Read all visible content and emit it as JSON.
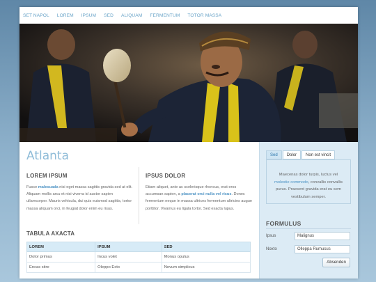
{
  "nav": {
    "items": [
      "SET NAPOL",
      "LOREM",
      "IPSUM",
      "SED",
      "ALIQUAM",
      "FERMENTUM",
      "TOTOR MASSA"
    ]
  },
  "main": {
    "title": "Atlanta",
    "col1": {
      "heading": "LOREM IPSUM",
      "text_before": "Fusce ",
      "link": "malesuada",
      "text_after": " nisi eget massa sagittis gravida sed at elit. Aliquam mollis arcu et nisi viverra id auctor sapien ullamcorper. Mauris vehicula, dui quis euismod sagittis, tortor massa aliquam orci, in feugiat dolor enim eu risus."
    },
    "col2": {
      "heading": "IPSUS DOLOR",
      "text_before": "Etiam aliquet, ante ac scelerisque rhoncus, erat eros accumsan sapien, a ",
      "link": "placerat orci nulla vel risus",
      "text_after": ". Donec fermentum neque in massa ultrices fermentum ultricies augue porttitor. Vivamus eu ligula tortor. Sed exacta lupus."
    },
    "table": {
      "heading": "TABULA AXACTA",
      "columns": [
        "LOREM",
        "IPSUM",
        "SED"
      ],
      "rows": [
        [
          "Dolor primus",
          "Incus volet",
          "Monus opulus"
        ],
        [
          "Encas sitre",
          "Oleppo Exto",
          "Novum simplicus"
        ]
      ]
    }
  },
  "sidebar": {
    "tabs": [
      "Sed",
      "Dolor",
      "Non est vincit"
    ],
    "tab_text_before": "Maecenas dolor turpis, luctus vel ",
    "tab_link": "molestie commodo",
    "tab_text_after": ", convallis convallis purus. Praesent gravida erat eu sem vestibulum semper.",
    "form": {
      "heading": "FORMULUS",
      "fields": [
        {
          "label": "Ipsus",
          "value": "Malignus"
        },
        {
          "label": "Noxto",
          "value": "Olleppa Rumusus"
        }
      ],
      "submit": "Absenden"
    }
  },
  "colors": {
    "accent": "#6aa4c8",
    "link": "#4d93c4",
    "sidebar_bg": "#dcebf5",
    "table_header_bg": "#d7ebf7"
  }
}
